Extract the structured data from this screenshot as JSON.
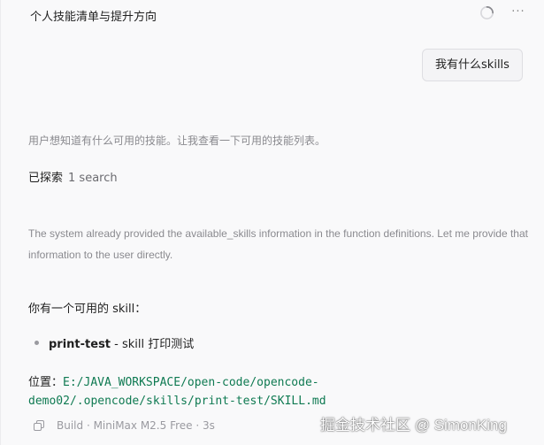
{
  "header": {
    "title": "个人技能清单与提升方向",
    "spinner_icon": "loading-spinner-icon",
    "more_icon": "more-horizontal-icon",
    "more_text": "···"
  },
  "user_message": {
    "text": "我有什么skills"
  },
  "assistant": {
    "thinking": "用户想知道有什么可用的技能。让我查看一下可用的技能列表。",
    "explored_label": "已探索",
    "explored_count": "1 search",
    "reasoning": "The system already provided the available_skills information in the function definitions. Let me provide that information to the user directly.",
    "answer_intro": "你有一个可用的 skill：",
    "skills": [
      {
        "name": "print-test",
        "description": " - skill 打印测试"
      }
    ],
    "path_label": "位置：",
    "path_line1": "E:/JAVA_WORKSPACE/open-code/opencode-",
    "path_line2": "demo02/.opencode/skills/print-test/SKILL.md",
    "footer": {
      "copy_icon": "copy-icon",
      "text": "Build · MiniMax M2.5 Free · 3s"
    }
  },
  "watermark": "掘金技术社区 @ SimonKing",
  "colors": {
    "background": "#f9f9fa",
    "muted_text": "#8a8a8f",
    "code_green": "#0f7a52",
    "bubble_bg": "#f4f4f6"
  }
}
